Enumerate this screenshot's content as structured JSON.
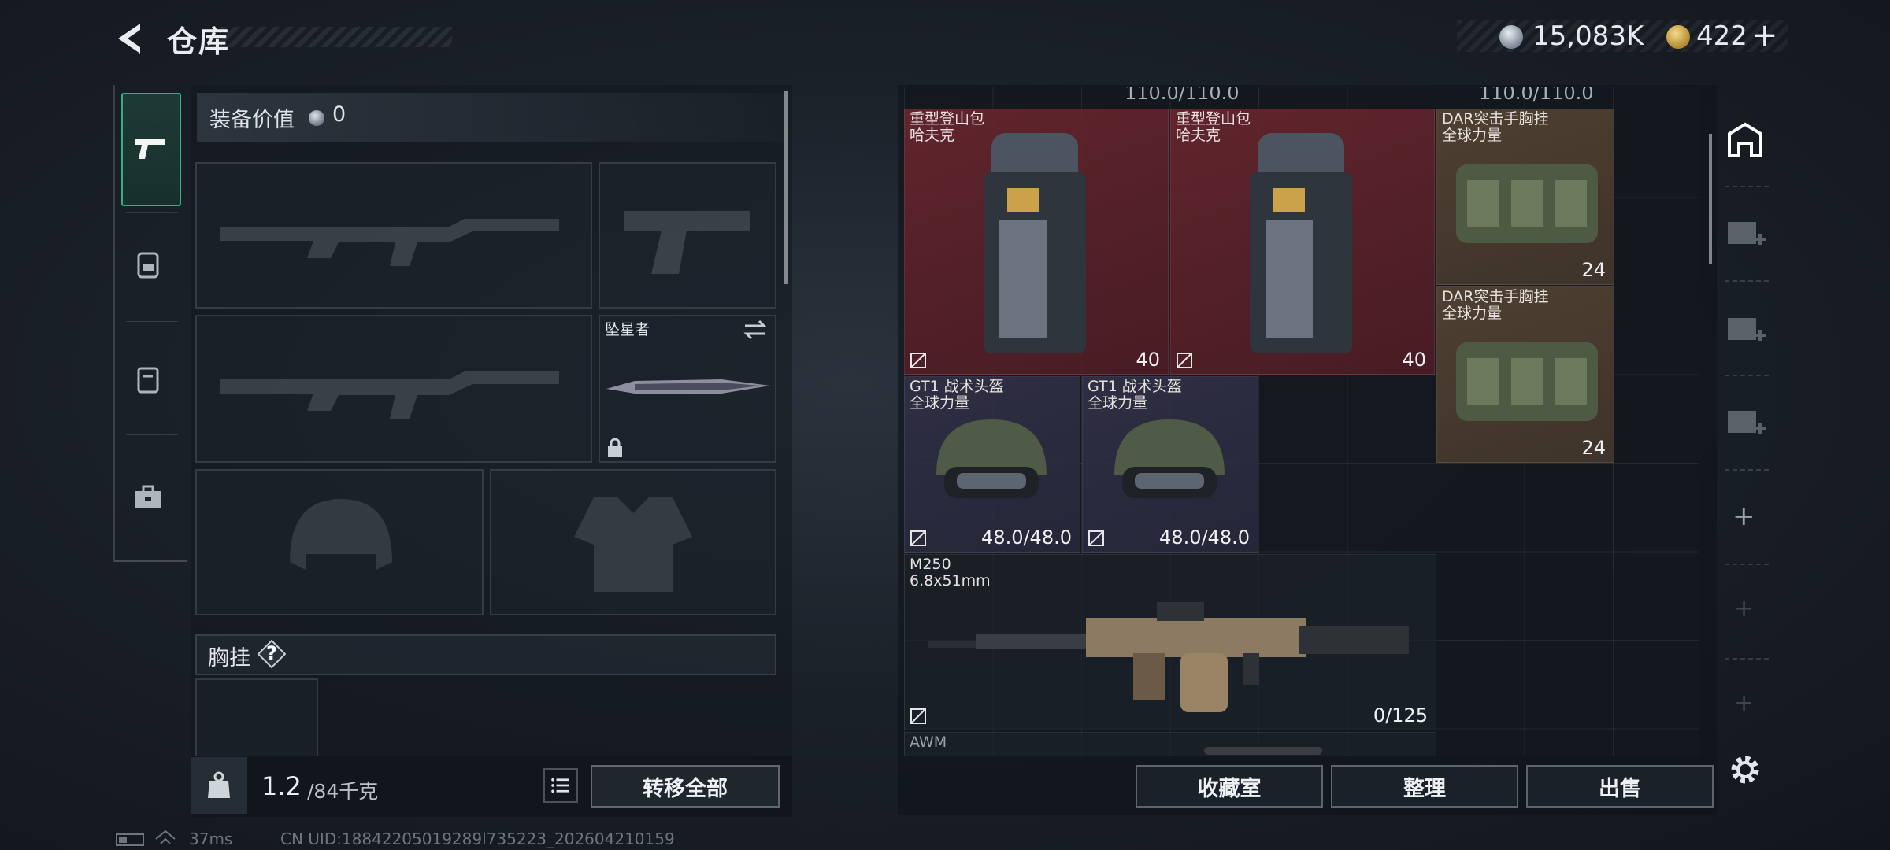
{
  "header": {
    "title": "仓库",
    "money": "15,083K",
    "tokens": "422",
    "plus": "+"
  },
  "loadout": {
    "value_label": "装备价值",
    "value": "0",
    "melee_name": "坠星者",
    "chest_label": "胸挂",
    "chest_help": "?",
    "weight_current": "1.2",
    "weight_max": "/84千克",
    "transfer_all": "转移全部"
  },
  "status": {
    "ping": "37ms",
    "uid": "CN UID:18842205019289l735223_202604210159"
  },
  "storage": {
    "cut_values": [
      "110.0/110.0",
      "110.0/110.0"
    ],
    "items": [
      {
        "name": "重型登山包",
        "sub": "哈夫克",
        "value": "40"
      },
      {
        "name": "重型登山包",
        "sub": "哈夫克",
        "value": "40"
      },
      {
        "name": "DAR突击手胸挂",
        "sub": "全球力量",
        "value": "24"
      },
      {
        "name": "DAR突击手胸挂",
        "sub": "全球力量",
        "value": "24"
      },
      {
        "name": "GT1 战术头盔",
        "sub": "全球力量",
        "value": "48.0/48.0"
      },
      {
        "name": "GT1 战术头盔",
        "sub": "全球力量",
        "value": "48.0/48.0"
      },
      {
        "name": "M250",
        "sub": "6.8x51mm",
        "value": "0/125"
      },
      {
        "name": "AWM",
        "sub": "",
        "value": ""
      }
    ]
  },
  "sidebar": {
    "add": "+"
  },
  "buttons": {
    "collection": "收藏室",
    "sort": "整理",
    "sell": "出售"
  },
  "colors": {
    "accent": "#2fb08a",
    "rarity_red": "#6e262e",
    "rarity_gold": "#584634",
    "rarity_purple": "#34324a"
  }
}
